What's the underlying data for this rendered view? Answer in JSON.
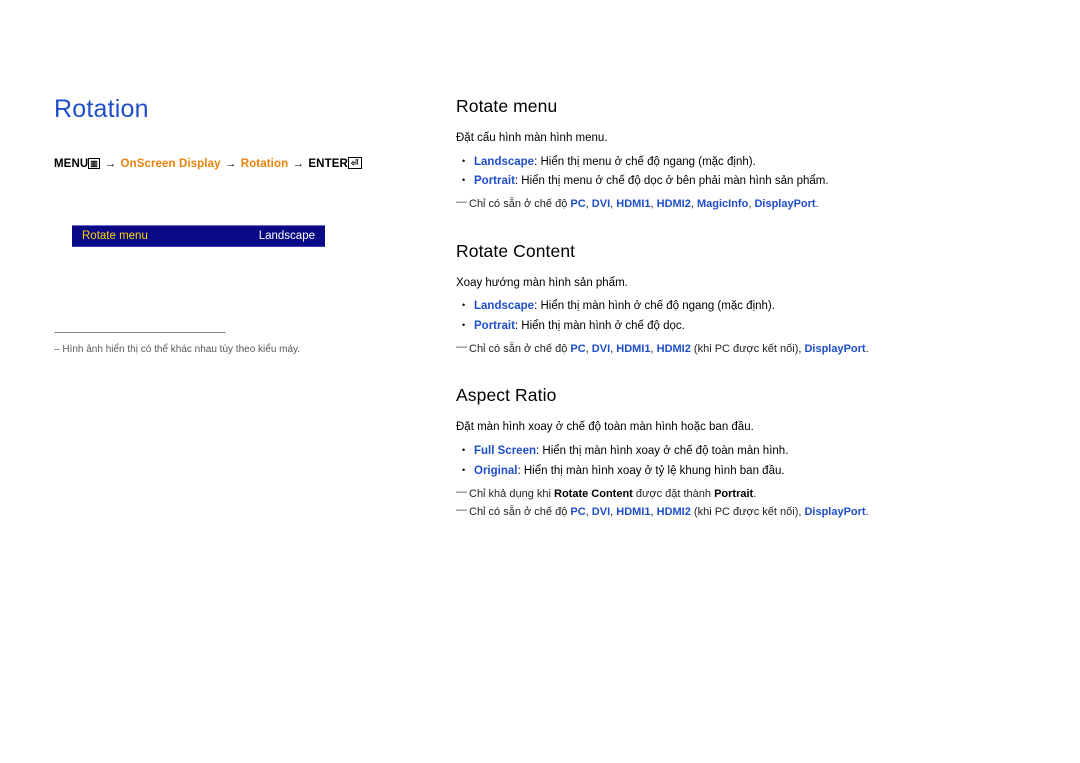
{
  "left": {
    "title": "Rotation",
    "menu_path": {
      "menu_label": "MENU",
      "menu_icon": "menu-grid-icon",
      "arrow": "→",
      "item1": "OnScreen Display",
      "item2": "Rotation",
      "enter_label": "ENTER",
      "enter_icon": "enter-key-icon"
    },
    "osd": {
      "label": "Rotate menu",
      "value": "Landscape"
    },
    "note": {
      "dash": "–",
      "text": "Hình ảnh hiển thị có thể khác nhau tùy theo kiểu máy."
    }
  },
  "right": {
    "sections": [
      {
        "heading": "Rotate menu",
        "intro": "Đặt cấu hình màn hình menu.",
        "bullets": [
          {
            "kw": "Landscape",
            "text": ": Hiển thị menu ở chế độ ngang (mặc định)."
          },
          {
            "kw": "Portrait",
            "text": ": Hiển thị menu ở chế độ dọc ở bên phải màn hình sản phẩm."
          }
        ],
        "footnotes": [
          {
            "dash": "—",
            "parts": [
              {
                "t": "Chỉ có sẵn ở chế độ ",
                "s": "plain"
              },
              {
                "t": "PC",
                "s": "blue"
              },
              {
                "t": ", ",
                "s": "plain"
              },
              {
                "t": "DVI",
                "s": "blue"
              },
              {
                "t": ", ",
                "s": "plain"
              },
              {
                "t": "HDMI1",
                "s": "blue"
              },
              {
                "t": ", ",
                "s": "plain"
              },
              {
                "t": "HDMI2",
                "s": "blue"
              },
              {
                "t": ", ",
                "s": "plain"
              },
              {
                "t": "MagicInfo",
                "s": "blue"
              },
              {
                "t": ", ",
                "s": "plain"
              },
              {
                "t": "DisplayPort",
                "s": "blue"
              },
              {
                "t": ".",
                "s": "plain"
              }
            ]
          }
        ]
      },
      {
        "heading": "Rotate Content",
        "intro": "Xoay hướng màn hình sản phẩm.",
        "bullets": [
          {
            "kw": "Landscape",
            "text": ": Hiển thị màn hình ở chế độ ngang (mặc định)."
          },
          {
            "kw": "Portrait",
            "text": ": Hiển thị màn hình ở chế độ dọc."
          }
        ],
        "footnotes": [
          {
            "dash": "—",
            "parts": [
              {
                "t": "Chỉ có sẵn ở chế độ ",
                "s": "plain"
              },
              {
                "t": "PC",
                "s": "blue"
              },
              {
                "t": ", ",
                "s": "plain"
              },
              {
                "t": "DVI",
                "s": "blue"
              },
              {
                "t": ", ",
                "s": "plain"
              },
              {
                "t": "HDMI1",
                "s": "blue"
              },
              {
                "t": ", ",
                "s": "plain"
              },
              {
                "t": "HDMI2",
                "s": "blue"
              },
              {
                "t": " (khi PC được kết nối), ",
                "s": "plain"
              },
              {
                "t": "DisplayPort",
                "s": "blue"
              },
              {
                "t": ".",
                "s": "plain"
              }
            ]
          }
        ]
      },
      {
        "heading": "Aspect Ratio",
        "intro": "Đặt màn hình xoay ở chế độ toàn màn hình hoặc ban đầu.",
        "bullets": [
          {
            "kw": "Full Screen",
            "text": ": Hiển thị màn hình xoay ở chế độ toàn màn hình."
          },
          {
            "kw": "Original",
            "text": ": Hiển thị màn hình xoay ở tỷ lệ khung hình ban đầu."
          }
        ],
        "footnotes": [
          {
            "dash": "—",
            "parts": [
              {
                "t": "Chỉ khả dụng khi ",
                "s": "plain"
              },
              {
                "t": "Rotate Content",
                "s": "bold"
              },
              {
                "t": " được đặt thành ",
                "s": "plain"
              },
              {
                "t": "Portrait",
                "s": "bold"
              },
              {
                "t": ".",
                "s": "plain"
              }
            ]
          },
          {
            "dash": "—",
            "parts": [
              {
                "t": "Chỉ có sẵn ở chế độ ",
                "s": "plain"
              },
              {
                "t": "PC",
                "s": "blue"
              },
              {
                "t": ", ",
                "s": "plain"
              },
              {
                "t": "DVI",
                "s": "blue"
              },
              {
                "t": ", ",
                "s": "plain"
              },
              {
                "t": "HDMI1",
                "s": "blue"
              },
              {
                "t": ", ",
                "s": "plain"
              },
              {
                "t": "HDMI2",
                "s": "blue"
              },
              {
                "t": " (khi PC được kết nối), ",
                "s": "plain"
              },
              {
                "t": "DisplayPort",
                "s": "blue"
              },
              {
                "t": ".",
                "s": "plain"
              }
            ]
          }
        ]
      }
    ]
  },
  "colors": {
    "title_blue": "#1f4ec8",
    "path_orange": "#e8820c",
    "osd_bg": "#0a0a86",
    "osd_label": "#ffd400"
  }
}
